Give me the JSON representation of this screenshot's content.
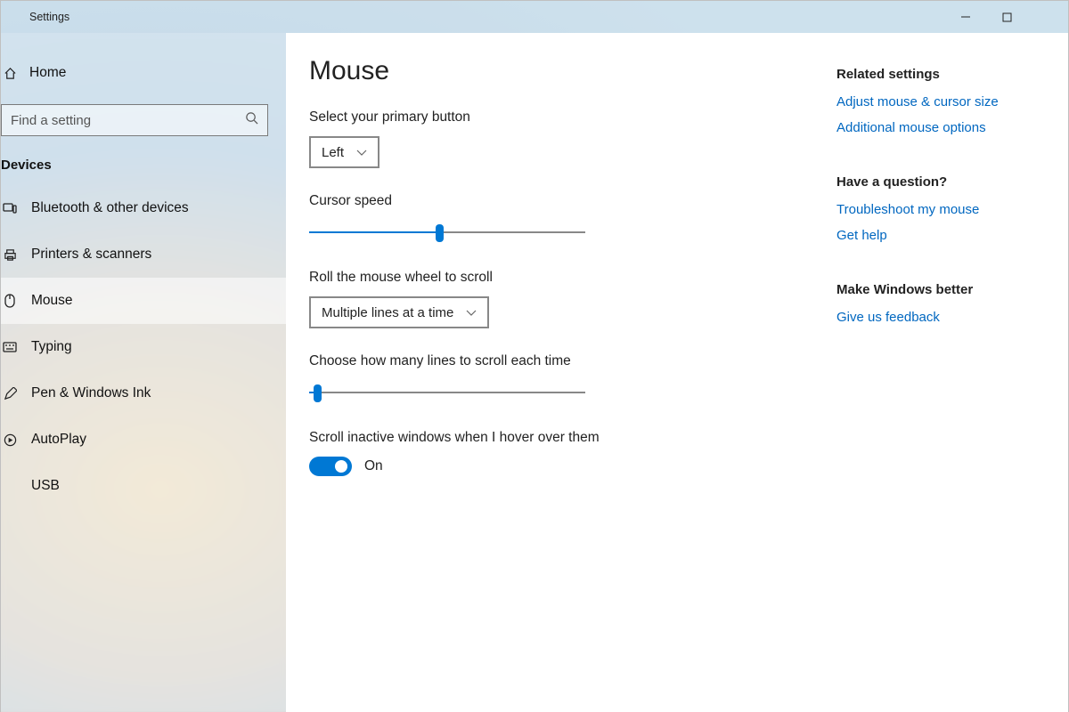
{
  "window": {
    "title": "Settings"
  },
  "sidebar": {
    "home": "Home",
    "search_placeholder": "Find a setting",
    "category": "Devices",
    "items": [
      {
        "label": "Bluetooth & other devices"
      },
      {
        "label": "Printers & scanners"
      },
      {
        "label": "Mouse"
      },
      {
        "label": "Typing"
      },
      {
        "label": "Pen & Windows Ink"
      },
      {
        "label": "AutoPlay"
      },
      {
        "label": "USB"
      }
    ]
  },
  "main": {
    "heading": "Mouse",
    "primary_button_label": "Select your primary button",
    "primary_button_value": "Left",
    "cursor_speed_label": "Cursor speed",
    "cursor_speed_pct": 47,
    "roll_wheel_label": "Roll the mouse wheel to scroll",
    "roll_wheel_value": "Multiple lines at a time",
    "lines_label": "Choose how many lines to scroll each time",
    "lines_pct": 3,
    "inactive_label": "Scroll inactive windows when I hover over them",
    "inactive_state": "On"
  },
  "rail": {
    "related_heading": "Related settings",
    "related_links": [
      "Adjust mouse & cursor size",
      "Additional mouse options"
    ],
    "question_heading": "Have a question?",
    "question_links": [
      "Troubleshoot my mouse",
      "Get help"
    ],
    "feedback_heading": "Make Windows better",
    "feedback_links": [
      "Give us feedback"
    ]
  }
}
